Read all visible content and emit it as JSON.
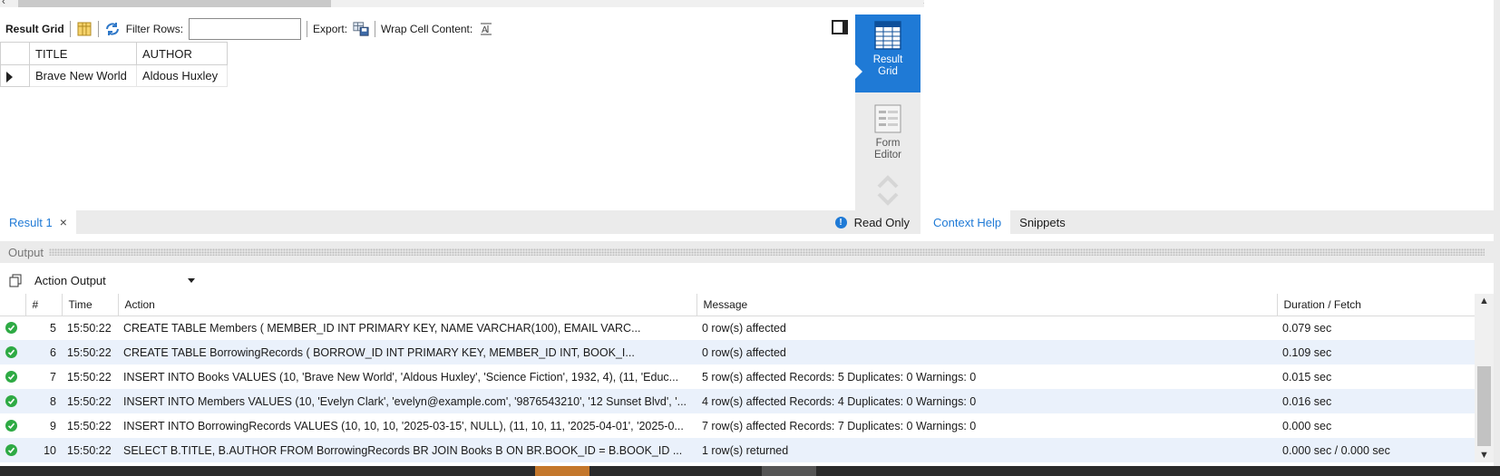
{
  "result_toolbar": {
    "result_grid_label": "Result Grid",
    "filter_label": "Filter Rows:",
    "filter_value": "",
    "export_label": "Export:",
    "wrap_label": "Wrap Cell Content:"
  },
  "result_grid": {
    "columns": [
      "TITLE",
      "AUTHOR"
    ],
    "rows": [
      [
        "Brave New World",
        "Aldous Huxley"
      ]
    ]
  },
  "side_tools": {
    "result_grid_line1": "Result",
    "result_grid_line2": "Grid",
    "form_editor_line1": "Form",
    "form_editor_line2": "Editor"
  },
  "result_tabs": {
    "tab_label": "Result 1",
    "read_only_label": "Read Only"
  },
  "help_tabs": {
    "context_help": "Context Help",
    "snippets": "Snippets"
  },
  "output": {
    "header_label": "Output",
    "selector_value": "Action Output",
    "columns": [
      "#",
      "Time",
      "Action",
      "Message",
      "Duration / Fetch"
    ],
    "rows": [
      {
        "num": "5",
        "time": "15:50:22",
        "action": "CREATE TABLE Members (     MEMBER_ID INT PRIMARY KEY,     NAME VARCHAR(100),     EMAIL VARC...",
        "message": "0 row(s) affected",
        "duration": "0.079 sec"
      },
      {
        "num": "6",
        "time": "15:50:22",
        "action": "CREATE TABLE BorrowingRecords (     BORROW_ID INT PRIMARY KEY,     MEMBER_ID INT,     BOOK_I...",
        "message": "0 row(s) affected",
        "duration": "0.109 sec"
      },
      {
        "num": "7",
        "time": "15:50:22",
        "action": "INSERT INTO Books VALUES (10, 'Brave New World', 'Aldous Huxley', 'Science Fiction', 1932, 4), (11, 'Educ...",
        "message": "5 row(s) affected Records: 5  Duplicates: 0  Warnings: 0",
        "duration": "0.015 sec"
      },
      {
        "num": "8",
        "time": "15:50:22",
        "action": "INSERT INTO Members VALUES (10, 'Evelyn Clark', 'evelyn@example.com', '9876543210', '12 Sunset Blvd', '...",
        "message": "4 row(s) affected Records: 4  Duplicates: 0  Warnings: 0",
        "duration": "0.016 sec"
      },
      {
        "num": "9",
        "time": "15:50:22",
        "action": "INSERT INTO BorrowingRecords VALUES (10, 10, 10, '2025-03-15', NULL), (11, 10, 11, '2025-04-01', '2025-0...",
        "message": "7 row(s) affected Records: 7  Duplicates: 0  Warnings: 0",
        "duration": "0.000 sec"
      },
      {
        "num": "10",
        "time": "15:50:22",
        "action": "SELECT B.TITLE, B.AUTHOR FROM BorrowingRecords BR JOIN Books B ON BR.BOOK_ID = B.BOOK_ID ...",
        "message": "1 row(s) returned",
        "duration": "0.000 sec / 0.000 sec"
      }
    ]
  },
  "icons": {
    "status_ok": "check-circle-icon",
    "accent": "#1f7ad6",
    "ok_color": "#2eaa44"
  }
}
